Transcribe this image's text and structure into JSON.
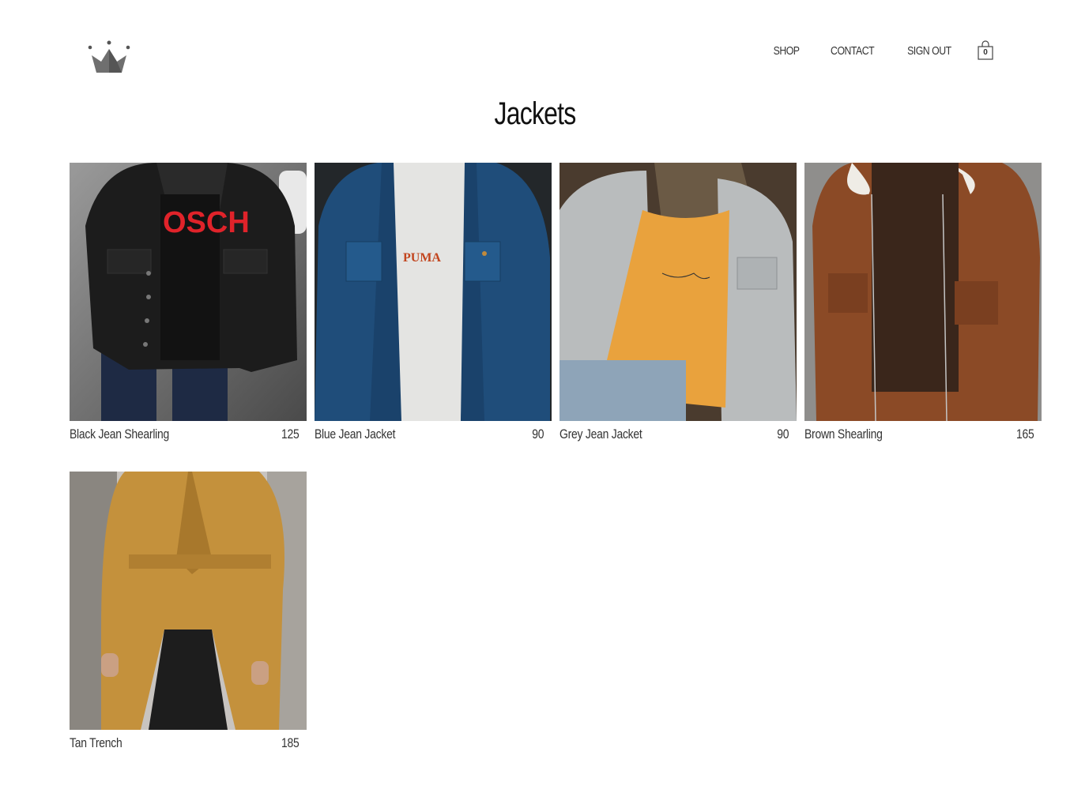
{
  "header": {
    "logo_icon": "crown-icon",
    "nav": [
      {
        "label": "SHOP"
      },
      {
        "label": "CONTACT"
      },
      {
        "label": "SIGN OUT"
      }
    ],
    "cart": {
      "icon": "shopping-bag-icon",
      "count": "0"
    }
  },
  "page": {
    "title": "Jackets"
  },
  "products": [
    {
      "name": "Black Jean Shearling",
      "price": "125",
      "image_desc": "person in black denim jacket with red-print tee"
    },
    {
      "name": "Blue Jean Jacket",
      "price": "90",
      "image_desc": "person in blue denim jacket with white PUMA tee"
    },
    {
      "name": "Grey Jean Jacket",
      "price": "90",
      "image_desc": "person in light grey denim jacket with orange tee"
    },
    {
      "name": "Brown Shearling",
      "price": "165",
      "image_desc": "person in brown suede shearling jacket"
    },
    {
      "name": "Tan Trench",
      "price": "185",
      "image_desc": "person in tan belted trench coat"
    }
  ]
}
